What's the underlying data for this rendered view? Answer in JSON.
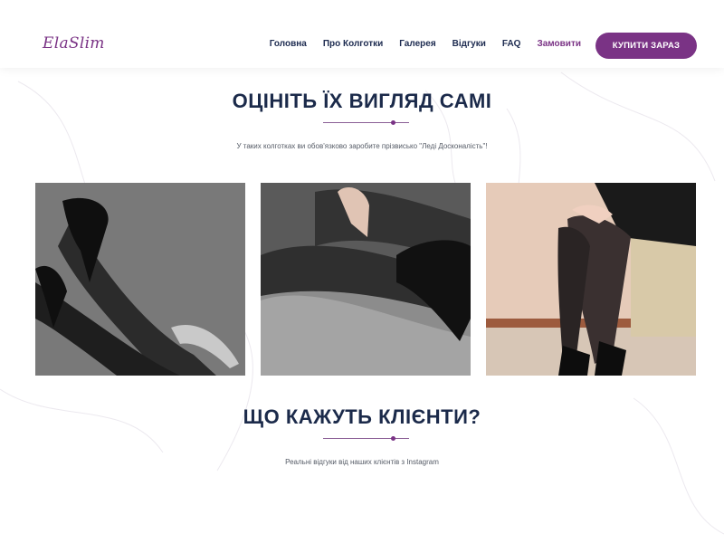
{
  "header": {
    "logo": "ElaSlim",
    "nav": [
      {
        "label": "Головна",
        "accent": false
      },
      {
        "label": "Про Колготки",
        "accent": false
      },
      {
        "label": "Галерея",
        "accent": false
      },
      {
        "label": "Відгуки",
        "accent": false
      },
      {
        "label": "FAQ",
        "accent": false
      },
      {
        "label": "Замовити",
        "accent": true
      }
    ],
    "cta": "КУПИТИ ЗАРАЗ"
  },
  "gallery_section": {
    "title": "ОЦІНІТЬ ЇХ ВИГЛЯД САМІ",
    "subtitle": "У таких колготках ви обов'язково заробите прізвисько \"Леді Досконалість\"!"
  },
  "reviews_section": {
    "title": "ЩО КАЖУТЬ КЛІЄНТИ?",
    "subtitle": "Реальні відгуки від наших клієнтів з Instagram"
  },
  "colors": {
    "brand": "#7a3385",
    "heading": "#1b2a4a",
    "nav_text": "#1d2b50"
  }
}
